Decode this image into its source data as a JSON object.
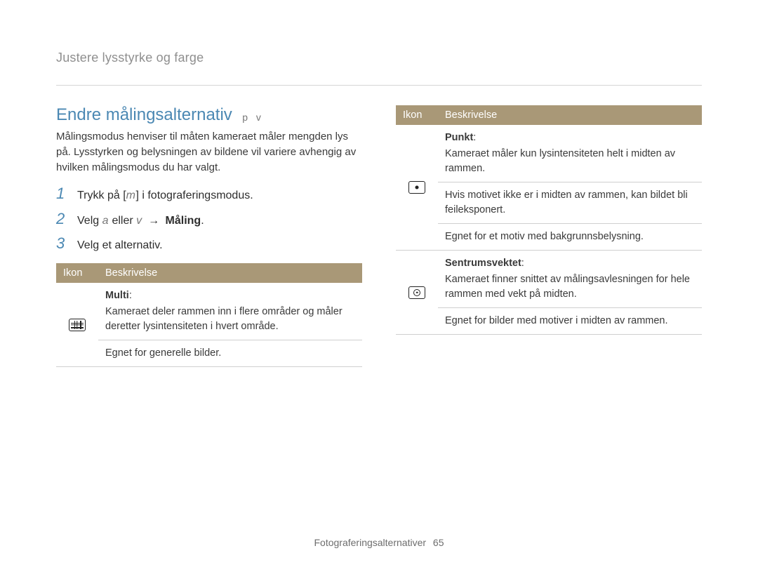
{
  "breadcrumb": "Justere lysstyrke og farge",
  "section": {
    "title": "Endre målingsalternativ",
    "tags": "p   v",
    "lead": "Målingsmodus henviser til måten kameraet måler mengden lys på. Lysstyrken og belysningen av bildene vil variere avhengig av hvilken målingsmodus du har valgt."
  },
  "steps": [
    {
      "num": "1",
      "pre": "Trykk på [",
      "glyph": "m",
      "post": "] i fotograferingsmodus."
    },
    {
      "num": "2",
      "pre": "Velg ",
      "g1": "a",
      "mid": " eller ",
      "g2": "v",
      "arrow": "→",
      "target": "Måling",
      "end": "."
    },
    {
      "num": "3",
      "text": "Velg et alternativ."
    }
  ],
  "table_headers": {
    "icon": "Ikon",
    "desc": "Beskrivelse"
  },
  "left_rows": [
    {
      "icon_name": "metering-multi-icon",
      "term": "Multi",
      "colon": ":",
      "lines": [
        "Kameraet deler rammen inn i flere områder og måler deretter lysintensiteten i hvert område.",
        "Egnet for generelle bilder."
      ]
    }
  ],
  "right_rows": [
    {
      "icon_name": "metering-spot-icon",
      "term": "Punkt",
      "colon": ":",
      "lines": [
        "Kameraet måler kun lysintensiteten helt i midten av rammen.",
        "Hvis motivet ikke er i midten av rammen, kan bildet bli feileksponert.",
        "Egnet for et motiv med bakgrunnsbelysning."
      ]
    },
    {
      "icon_name": "metering-center-weighted-icon",
      "term": "Sentrumsvektet",
      "colon": ":",
      "lines": [
        "Kameraet finner snittet av målingsavlesningen for hele rammen med vekt på midten.",
        "Egnet for bilder med motiver i midten av rammen."
      ]
    }
  ],
  "footer": {
    "label": "Fotograferingsalternativer",
    "page": "65"
  }
}
